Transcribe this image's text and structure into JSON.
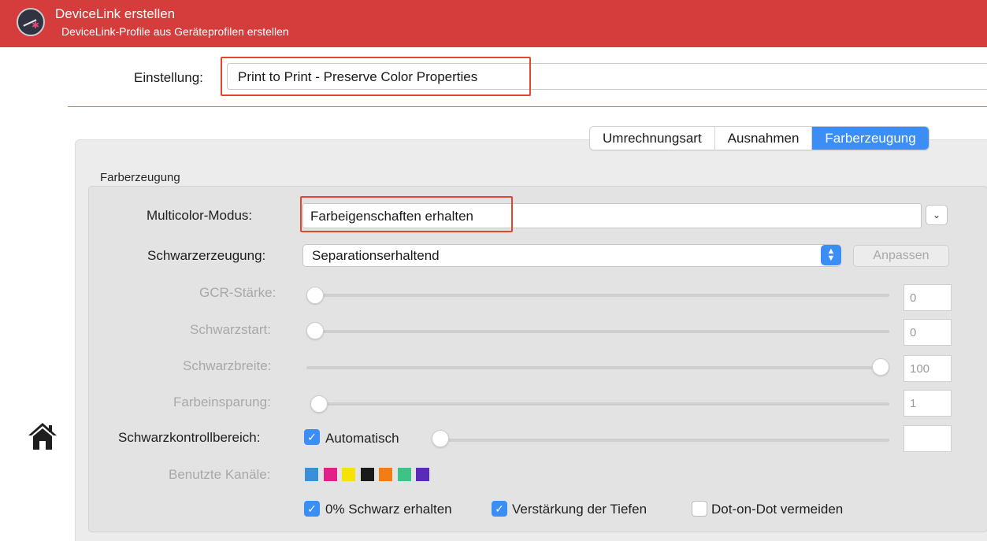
{
  "header": {
    "title": "DeviceLink erstellen",
    "subtitle": "DeviceLink-Profile aus Geräteprofilen erstellen",
    "logo_icon": "gauge-logo-icon"
  },
  "einstellung": {
    "label": "Einstellung:",
    "value": "Print to Print - Preserve Color Properties"
  },
  "tabs": [
    {
      "label": "Umrechnungsart",
      "active": false
    },
    {
      "label": "Ausnahmen",
      "active": false
    },
    {
      "label": "Farberzeugung",
      "active": true
    }
  ],
  "group_title": "Farberzeugung",
  "multicolor": {
    "label": "Multicolor-Modus:",
    "value": "Farbeigenschaften erhalten"
  },
  "schwarzerzeugung": {
    "label": "Schwarzerzeugung:",
    "value": "Separationserhaltend",
    "button": "Anpassen"
  },
  "sliders": [
    {
      "label": "GCR-Stärke:",
      "value": "0",
      "level": 0.0
    },
    {
      "label": "Schwarzstart:",
      "value": "0",
      "level": 0.0
    },
    {
      "label": "Schwarzbreite:",
      "value": "100",
      "level": 1.0
    },
    {
      "label": "Farbeinsparung:",
      "value": "1",
      "level": 0.01
    }
  ],
  "schwarzkontroll": {
    "label": "Schwarzkontrollbereich:",
    "checkbox_label": "Automatisch",
    "checked": true,
    "value": ""
  },
  "kanaele": {
    "label": "Benutzte Kanäle:",
    "colors": [
      "#3a8fd9",
      "#e0218a",
      "#f7e300",
      "#1a1a1a",
      "#f07d16",
      "#3cc389",
      "#5a2bb8"
    ]
  },
  "options": [
    {
      "label": "0% Schwarz erhalten",
      "checked": true
    },
    {
      "label": "Verstärkung der Tiefen",
      "checked": true
    },
    {
      "label": "Dot-on-Dot vermeiden",
      "checked": false
    }
  ],
  "colors": {
    "header_red": "#d53c3c",
    "accent_blue": "#3b8ef5",
    "highlight_red": "#e2462f"
  }
}
